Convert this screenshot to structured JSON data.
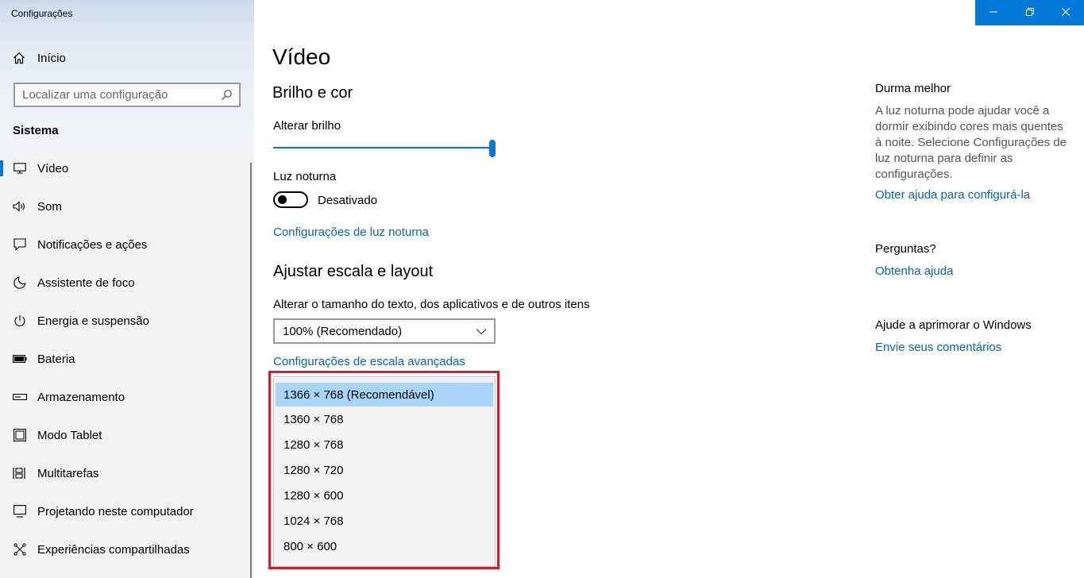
{
  "window": {
    "title": "Configurações"
  },
  "sidebar": {
    "home_label": "Início",
    "search_placeholder": "Localizar uma configuração",
    "section_title": "Sistema",
    "items": [
      {
        "label": "Vídeo",
        "icon": "monitor-icon",
        "active": true
      },
      {
        "label": "Som",
        "icon": "speaker-icon"
      },
      {
        "label": "Notificações e ações",
        "icon": "notification-icon"
      },
      {
        "label": "Assistente de foco",
        "icon": "moon-icon"
      },
      {
        "label": "Energia e suspensão",
        "icon": "power-icon"
      },
      {
        "label": "Bateria",
        "icon": "battery-icon"
      },
      {
        "label": "Armazenamento",
        "icon": "storage-icon"
      },
      {
        "label": "Modo Tablet",
        "icon": "tablet-icon"
      },
      {
        "label": "Multitarefas",
        "icon": "multitask-icon"
      },
      {
        "label": "Projetando neste computador",
        "icon": "project-icon"
      },
      {
        "label": "Experiências compartilhadas",
        "icon": "share-icon"
      }
    ]
  },
  "main": {
    "title": "Vídeo",
    "brightness_section": "Brilho e cor",
    "brightness_label": "Alterar brilho",
    "brightness_value": 100,
    "night_light_label": "Luz noturna",
    "night_light_state": "Desativado",
    "night_light_link": "Configurações de luz noturna",
    "scale_section": "Ajustar escala e layout",
    "scale_label": "Alterar o tamanho do texto, dos aplicativos e de outros itens",
    "scale_value": "100% (Recomendado)",
    "advanced_scale_link": "Configurações de escala avançadas",
    "resolution_options": [
      "1366 × 768 (Recomendável)",
      "1360 × 768",
      "1280 × 768",
      "1280 × 720",
      "1280 × 600",
      "1024 × 768",
      "800 × 600"
    ],
    "resolution_selected": 0
  },
  "right": {
    "sleep_title": "Durma melhor",
    "sleep_text": "A luz noturna pode ajudar você a dormir exibindo cores mais quentes à noite. Selecione Configurações de luz noturna para definir as configurações.",
    "sleep_link": "Obter ajuda para configurá-la",
    "questions_title": "Perguntas?",
    "questions_link": "Obtenha ajuda",
    "improve_title": "Ajude a aprimorar o Windows",
    "improve_link": "Envie seus comentários"
  },
  "colors": {
    "accent": "#0078d7",
    "link": "#0067b8",
    "highlight": "#d0202a"
  }
}
